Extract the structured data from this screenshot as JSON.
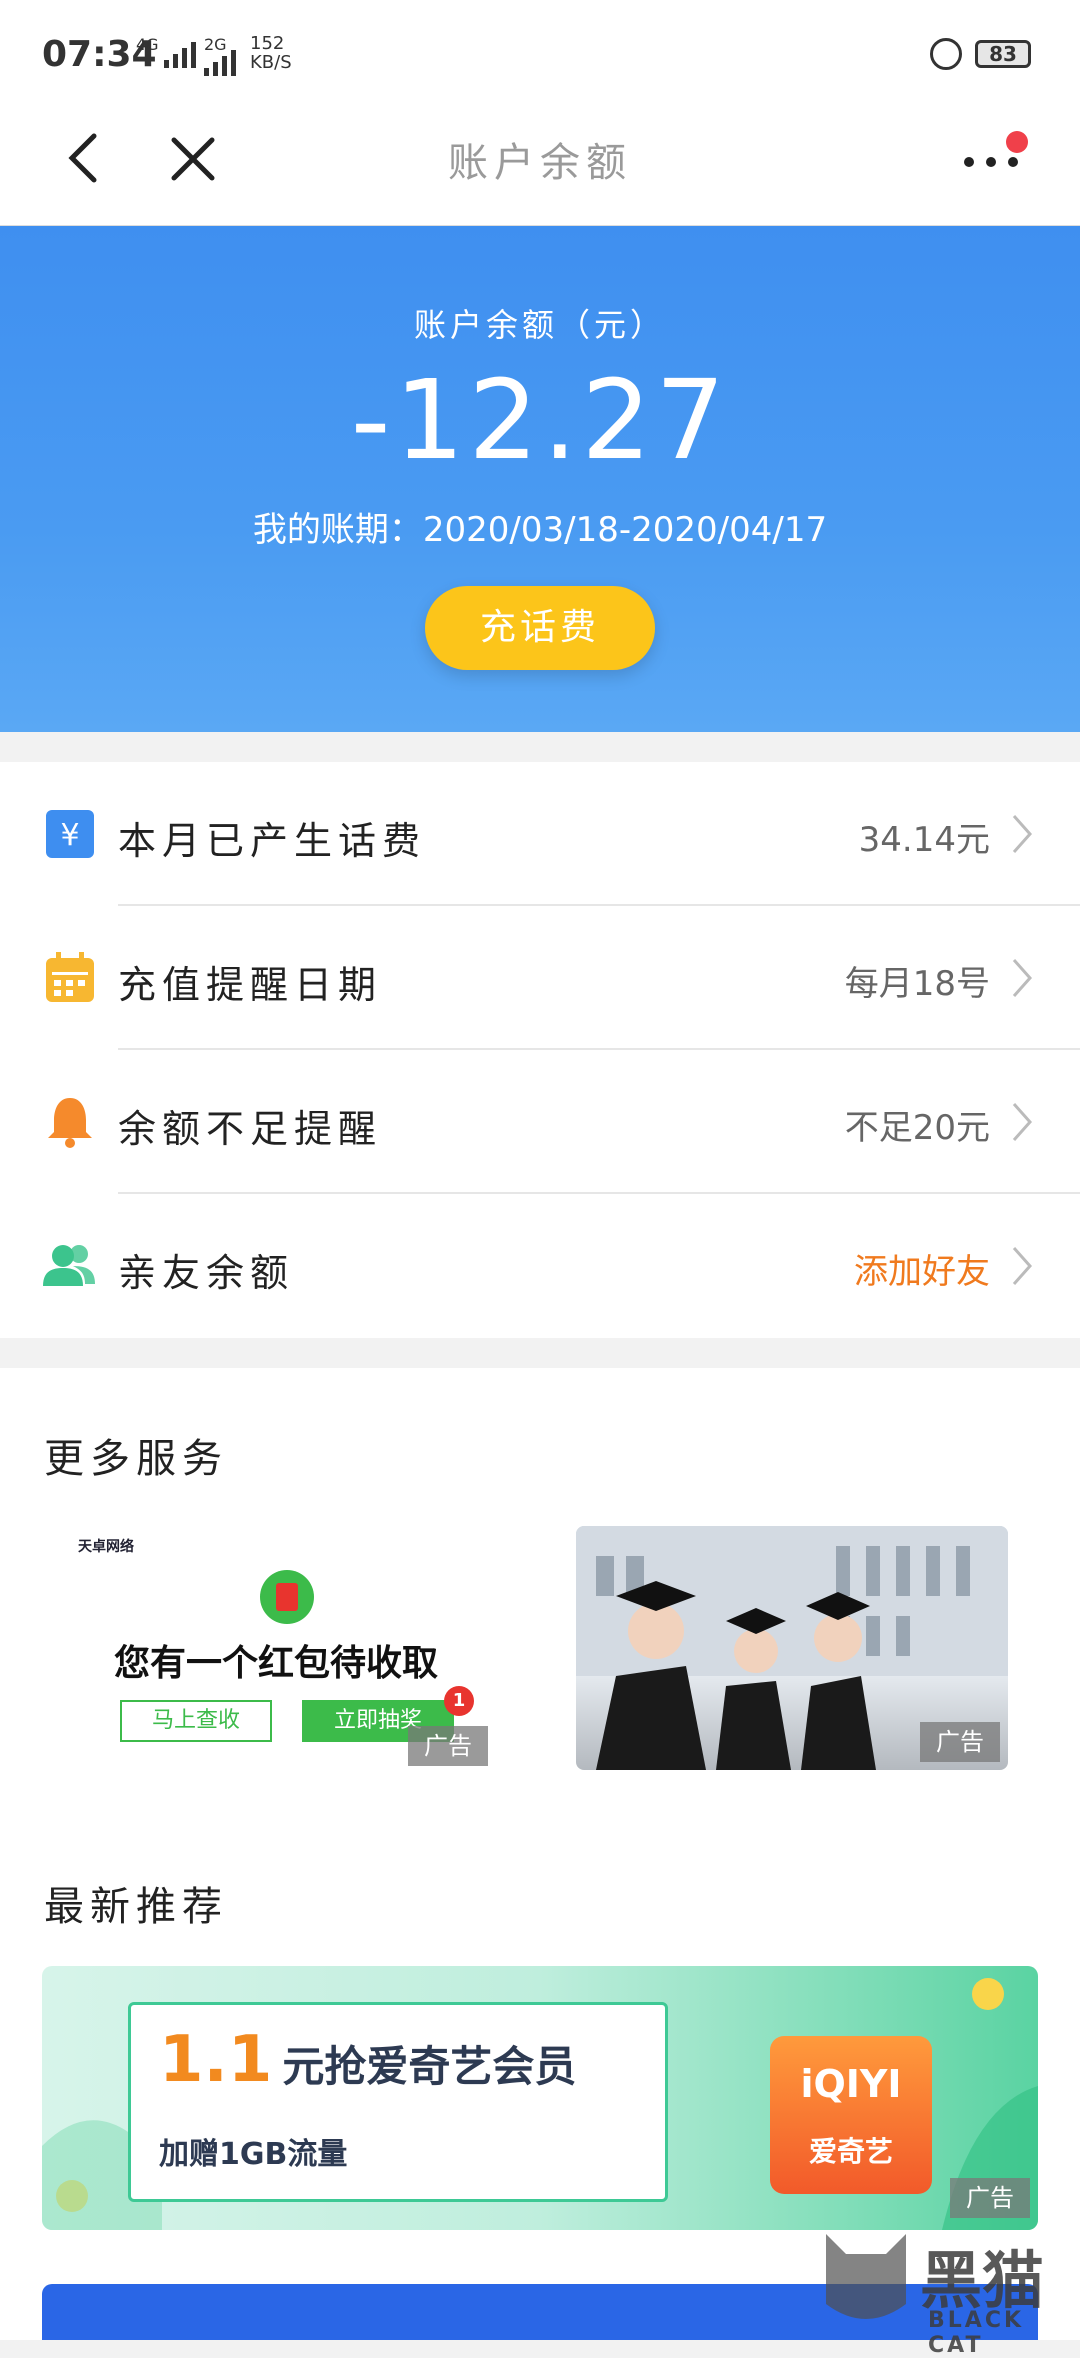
{
  "status_bar": {
    "time": "07:34",
    "network_1": "4G",
    "network_2": "2G",
    "speed_value": "152",
    "speed_unit": "KB/S",
    "battery": "83"
  },
  "nav": {
    "title": "账户余额"
  },
  "balance": {
    "label": "账户余额（元）",
    "amount": "-12.27",
    "period": "我的账期：2020/03/18-2020/04/17",
    "recharge_button": "充话费"
  },
  "list": [
    {
      "label": "本月已产生话费",
      "value": "34.14元",
      "icon": "yuan-icon",
      "icon_color": "#3e8ef0",
      "value_color": "#666666"
    },
    {
      "label": "充值提醒日期",
      "value": "每月18号",
      "icon": "calendar-icon",
      "icon_color": "#f7b731",
      "value_color": "#666666"
    },
    {
      "label": "余额不足提醒",
      "value": "不足20元",
      "icon": "bell-icon",
      "icon_color": "#f58a2c",
      "value_color": "#666666"
    },
    {
      "label": "亲友余额",
      "value": "添加好友",
      "icon": "friends-icon",
      "icon_color": "#3cc48d",
      "value_color": "#f07a1e"
    }
  ],
  "more_services": {
    "title": "更多服务",
    "ad1": {
      "brand": "天卓网络",
      "text": "您有一个红包待收取",
      "btn_check": "马上查收",
      "btn_draw": "立即抽奖",
      "badge": "1",
      "tag": "广告"
    },
    "ad2": {
      "tag": "广告"
    }
  },
  "recommend": {
    "title": "最新推荐",
    "ad": {
      "price": "1.1",
      "headline": "元抢爱奇艺会员",
      "subline": "加赠1GB流量",
      "logo_top": "iQIYI",
      "logo_bottom": "爱奇艺",
      "tag": "广告"
    }
  },
  "watermark": {
    "cn": "黑猫",
    "en": "BLACK CAT"
  }
}
